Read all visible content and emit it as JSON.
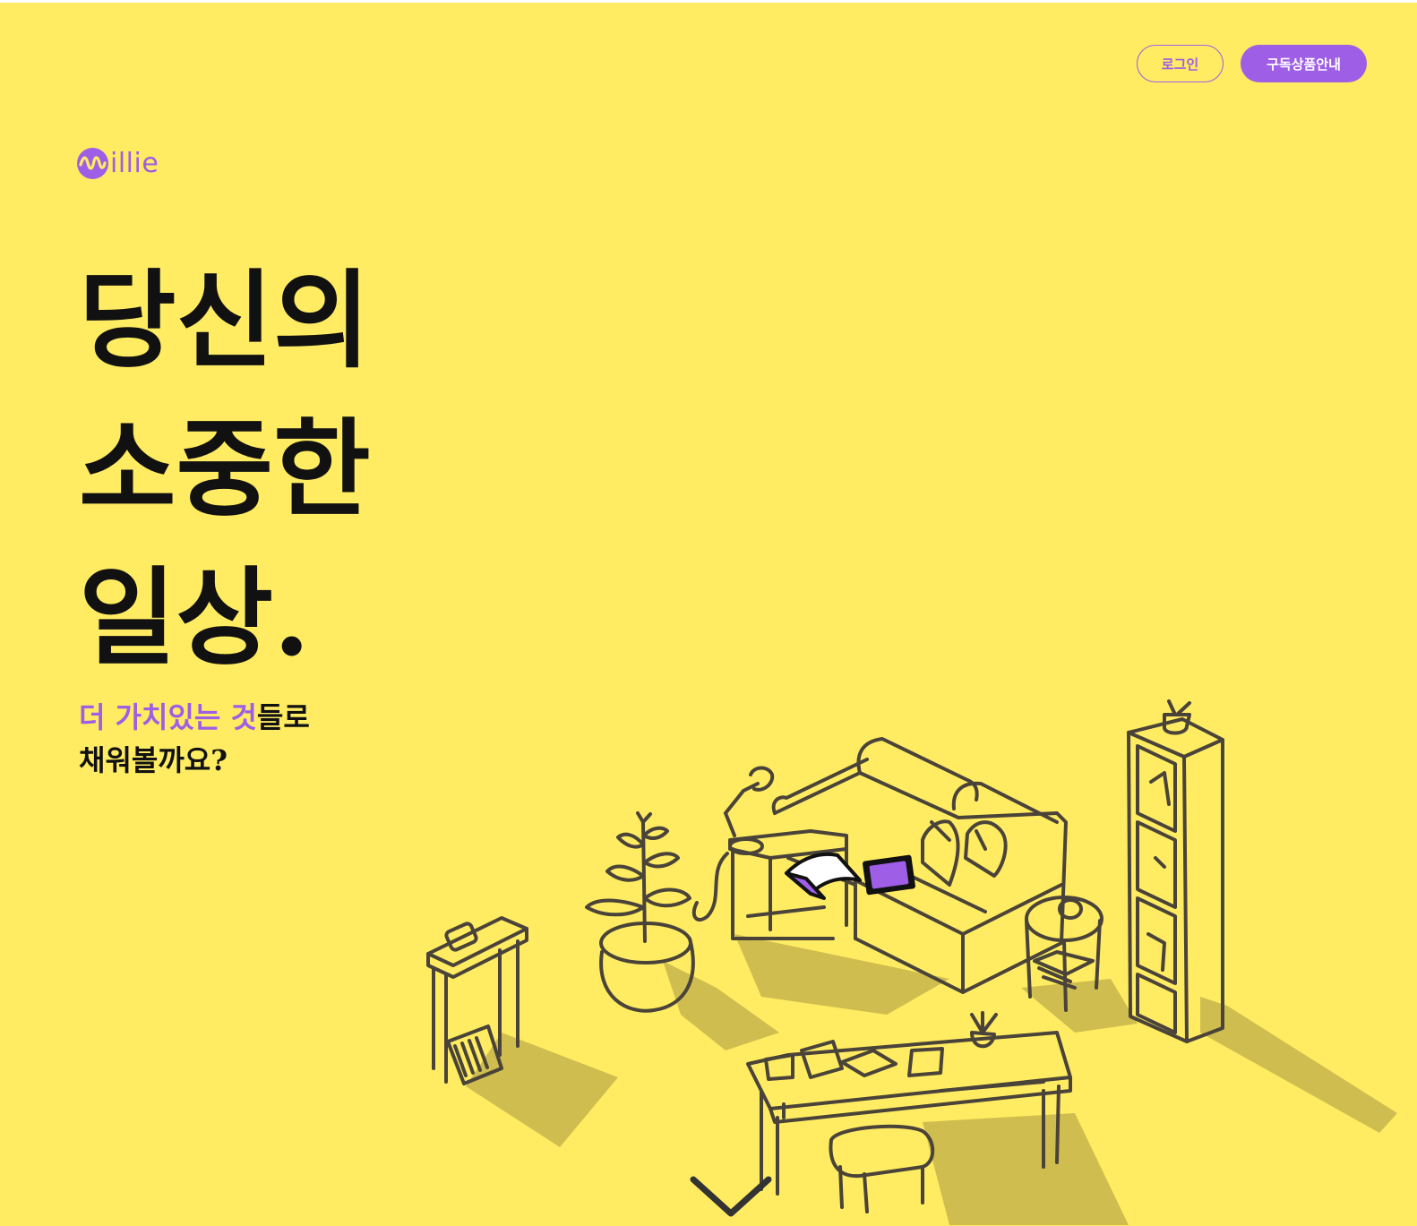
{
  "colors": {
    "background": "#ffec62",
    "accent": "#9e5ee6",
    "text": "#111111",
    "shadow": "#cfbe4f",
    "line": "#4a4339"
  },
  "header": {
    "login_label": "로그인",
    "subscribe_label": "구독상품안내"
  },
  "logo": {
    "text": "illie",
    "icon": "wave-logo-icon"
  },
  "hero": {
    "headline_lines": [
      "당신의",
      "소중한",
      "일상."
    ],
    "subline_highlight": "더 가치있는 것",
    "subline_rest": "들로",
    "subline_line2": "채워볼까요?"
  },
  "illustration": {
    "name": "isometric-living-room-illustration"
  },
  "scroll": {
    "icon": "chevron-down-icon"
  }
}
